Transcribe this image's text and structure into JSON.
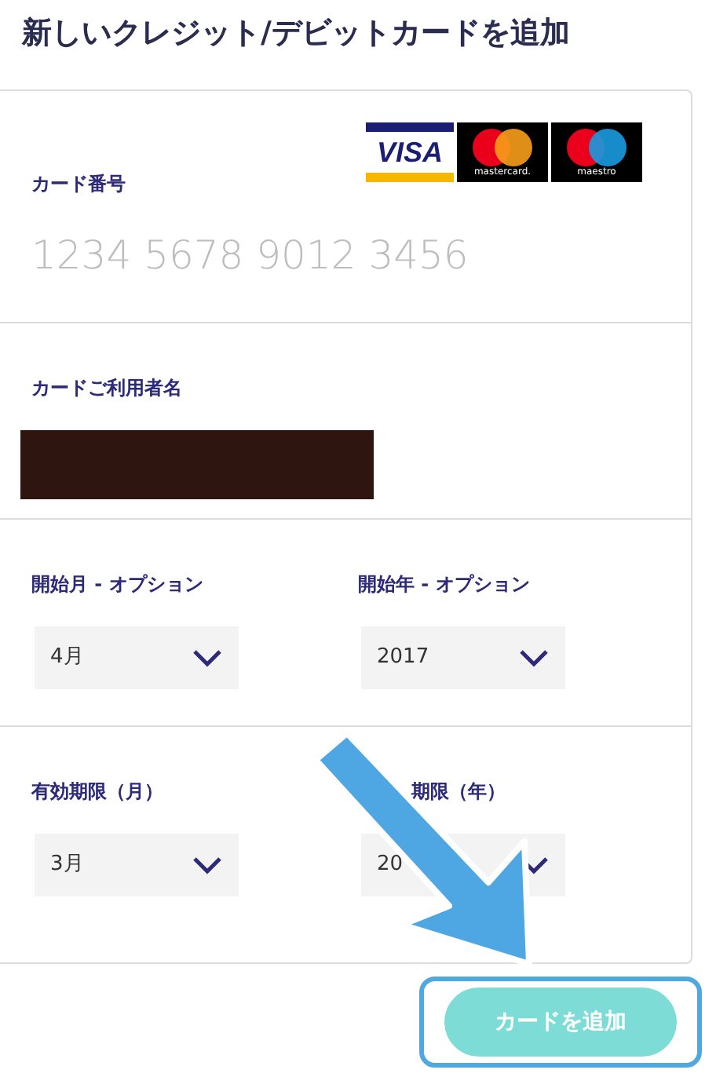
{
  "title": "新しいクレジット/デビットカードを追加",
  "card_logos": [
    {
      "kind": "visa",
      "text": "VISA"
    },
    {
      "kind": "mastercard",
      "text": "mastercard."
    },
    {
      "kind": "maestro",
      "text": "maestro"
    }
  ],
  "card_number": {
    "label": "カード番号",
    "placeholder": "1234 5678 9012 3456"
  },
  "cardholder": {
    "label": "カードご利用者名",
    "redacted": true
  },
  "select_rows": [
    [
      {
        "label": "開始月 - オプション",
        "value": "4月"
      },
      {
        "label": "開始年 - オプション",
        "value": "2017"
      }
    ],
    [
      {
        "label": "有効期限（月）",
        "value": "3月"
      },
      {
        "label": "期限（年）",
        "value": "20"
      }
    ]
  ],
  "submit_button": {
    "label": "カードを追加"
  },
  "annotation": {
    "arrow": true,
    "highlight": true
  }
}
